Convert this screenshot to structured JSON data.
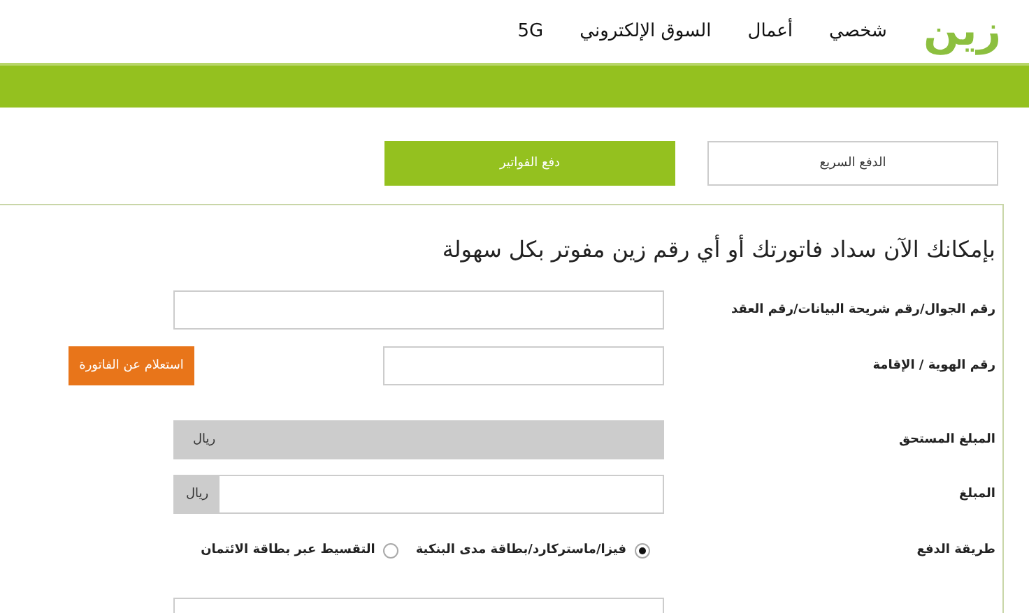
{
  "header": {
    "logo": "زين",
    "nav": [
      {
        "label": "شخصي"
      },
      {
        "label": "أعمال"
      },
      {
        "label": "السوق الإلكتروني"
      },
      {
        "label": "5G"
      }
    ]
  },
  "tabs": [
    {
      "label": "الدفع السريع",
      "selected": false
    },
    {
      "label": "دفع الفواتير",
      "selected": true
    }
  ],
  "form": {
    "title": "بإمكانك الآن سداد فاتورتك أو أي رقم زين مفوتر بكل سهولة",
    "rows": [
      {
        "kind": "input",
        "label": "رقم الجوال/رقم شريحة البيانات/رقم العقد"
      },
      {
        "kind": "input_button",
        "label": "رقم الهوية / الإقامة",
        "button": "استعلام عن الفاتورة"
      },
      {
        "kind": "readonly",
        "label": "المبلغ المستحق",
        "unit": "ريال"
      },
      {
        "kind": "unit_input",
        "label": "المبلغ",
        "unit": "ريال"
      },
      {
        "kind": "radio",
        "label": "طريقة الدفع",
        "options": [
          {
            "label": "فيزا/ماستركارد/بطاقة مدى البنكية",
            "selected": true
          },
          {
            "label": "التقسيط عبر بطاقة الائتمان",
            "selected": false
          }
        ]
      },
      {
        "kind": "input"
      }
    ]
  }
}
